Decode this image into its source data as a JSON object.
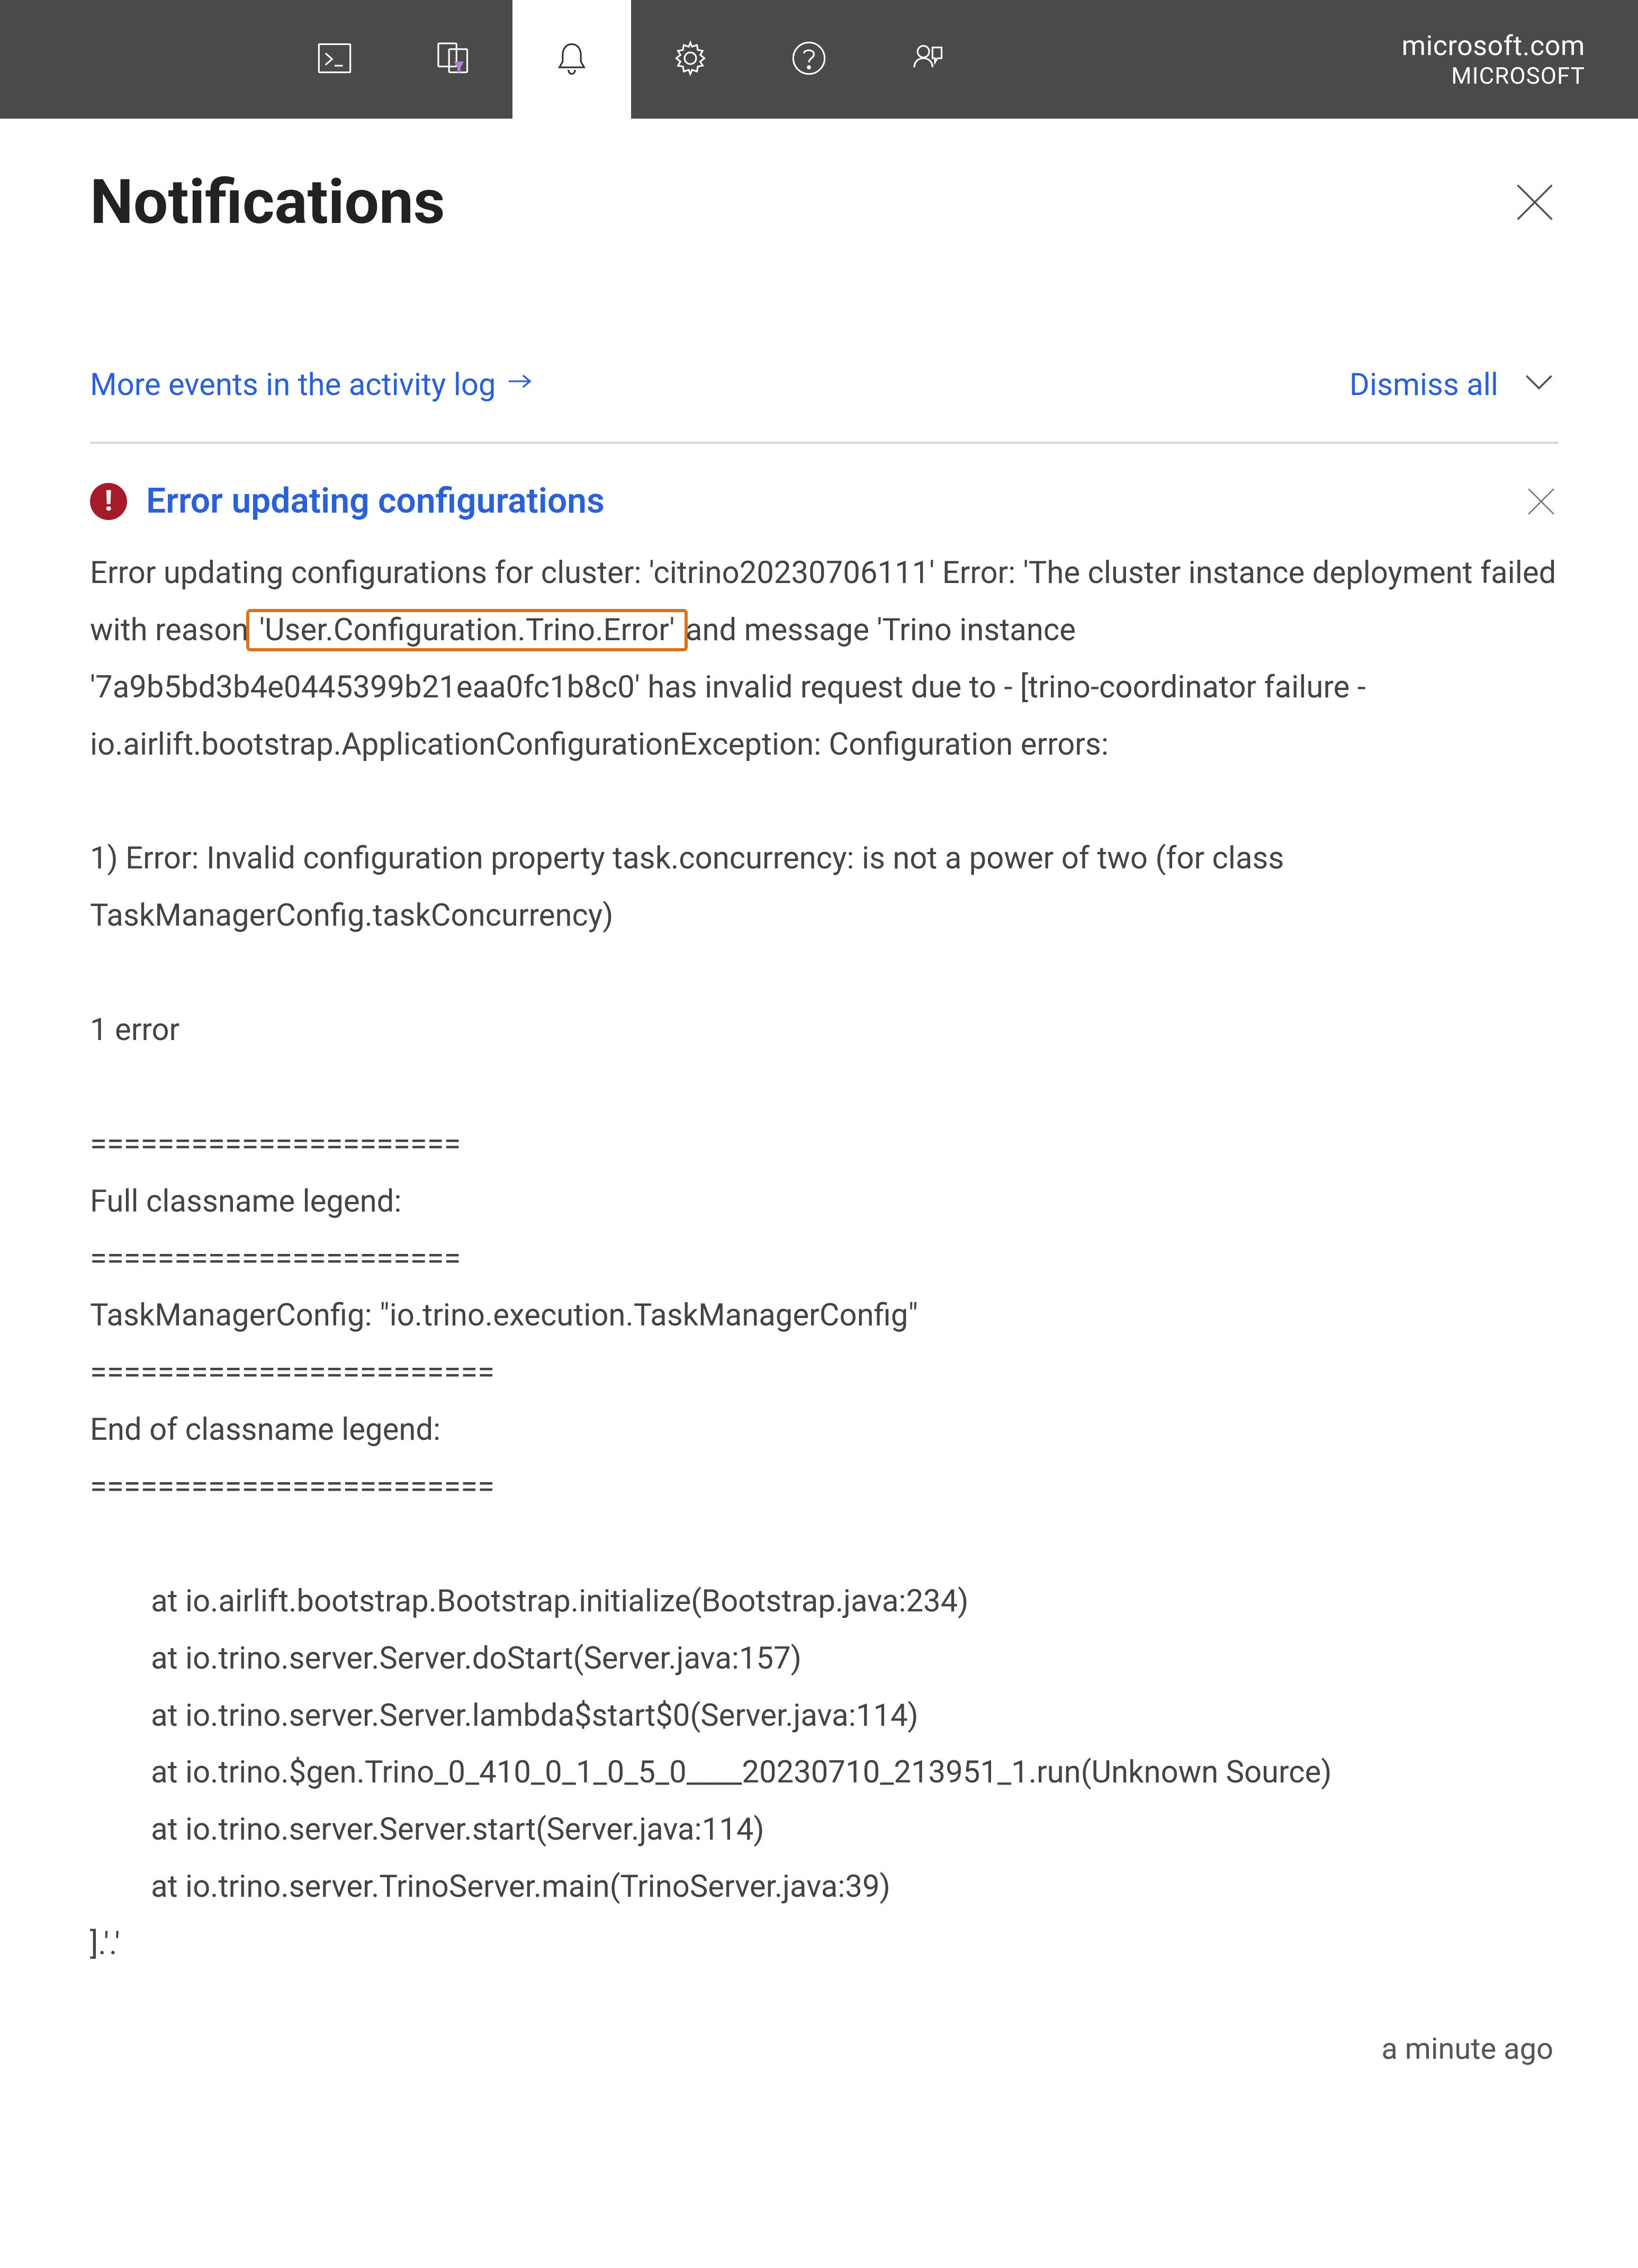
{
  "header": {
    "account_domain": "microsoft.com",
    "account_org": "MICROSOFT",
    "icons": {
      "cloud_shell": "cloud-shell",
      "directory_filter": "directory-filter",
      "notifications": "notifications",
      "settings": "settings",
      "help": "help",
      "feedback": "feedback"
    }
  },
  "panel": {
    "title": "Notifications",
    "more_events_label": "More events in the activity log",
    "dismiss_all_label": "Dismiss all"
  },
  "notification": {
    "title": "Error updating configurations",
    "body_pre": "Error updating configurations for cluster: 'citrino20230706111' Error: 'The cluster instance deployment failed with reason",
    "highlight_text": " 'User.Configuration.Trino.Error' ",
    "body_post": "and message 'Trino instance '7a9b5bd3b4e0445399b21eaa0fc1b8c0' has invalid request due to - [trino-coordinator failure - io.airlift.bootstrap.ApplicationConfigurationException: Configuration errors:\n\n1) Error: Invalid configuration property task.concurrency: is not a power of two (for class TaskManagerConfig.taskConcurrency)\n\n1 error\n\n======================\nFull classname legend:\n======================\nTaskManagerConfig: \"io.trino.execution.TaskManagerConfig\"\n========================\nEnd of classname legend:\n========================\n\n        at io.airlift.bootstrap.Bootstrap.initialize(Bootstrap.java:234)\n        at io.trino.server.Server.doStart(Server.java:157)\n        at io.trino.server.Server.lambda$start$0(Server.java:114)\n        at io.trino.$gen.Trino_0_410_0_1_0_5_0____20230710_213951_1.run(Unknown Source)\n        at io.trino.server.Server.start(Server.java:114)\n        at io.trino.server.TrinoServer.main(TrinoServer.java:39)\n].'.'",
    "timestamp": "a minute ago"
  }
}
